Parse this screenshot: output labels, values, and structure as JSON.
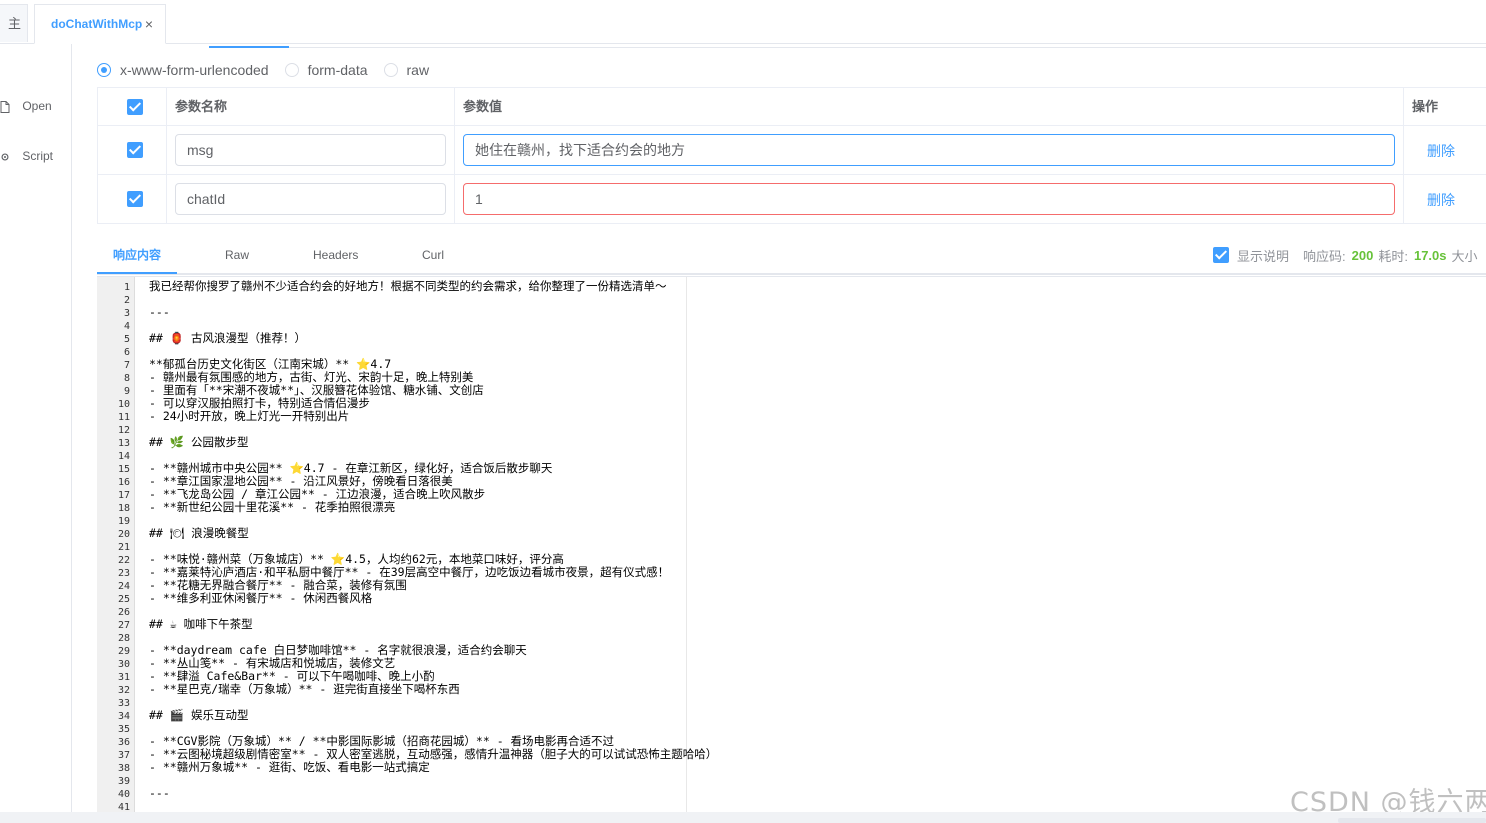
{
  "tabs": {
    "home_label": "主页",
    "active_label": "doChatWithMcp",
    "close_glyph": "×"
  },
  "left_rail": [
    {
      "label": "Open",
      "icon": "document-icon"
    },
    {
      "label": "Script",
      "icon": "gear-icon"
    }
  ],
  "body_types": [
    {
      "label": "x-www-form-urlencoded",
      "checked": true
    },
    {
      "label": "form-data",
      "checked": false
    },
    {
      "label": "raw",
      "checked": false
    }
  ],
  "params_table": {
    "headers": {
      "name": "参数名称",
      "value": "参数值",
      "action": "操作"
    },
    "rows": [
      {
        "enabled": true,
        "name": "msg",
        "value": "她住在赣州，找下适合约会的地方",
        "action": "删除"
      },
      {
        "enabled": true,
        "name": "chatId",
        "value": "1",
        "action": "删除"
      }
    ]
  },
  "response_tabs": [
    "响应内容",
    "Raw",
    "Headers",
    "Curl"
  ],
  "response_info": {
    "show_desc_label": "显示说明",
    "show_desc_checked": true,
    "status_label": "响应码:",
    "status_value": "200",
    "time_label": "耗时:",
    "time_value": "17.0s",
    "size_label": "大小"
  },
  "code_lines": [
    "我已经帮你搜罗了赣州不少适合约会的好地方！根据不同类型的约会需求，给你整理了一份精选清单～",
    "",
    "---",
    "",
    "## 🏮 古风浪漫型（推荐！）",
    "",
    "**郁孤台历史文化街区（江南宋城）** ⭐4.7",
    "- 赣州最有氛围感的地方，古街、灯光、宋韵十足，晚上特别美",
    "- 里面有「**宋潮不夜城**」、汉服簪花体验馆、糖水铺、文创店",
    "- 可以穿汉服拍照打卡，特别适合情侣漫步",
    "- 24小时开放，晚上灯光一开特别出片",
    "",
    "## 🌿 公园散步型",
    "",
    "- **赣州城市中央公园** ⭐4.7 - 在章江新区，绿化好，适合饭后散步聊天",
    "- **章江国家湿地公园** - 沿江风景好，傍晚看日落很美",
    "- **飞龙岛公园 / 章江公园** - 江边浪漫，适合晚上吹风散步",
    "- **新世纪公园十里花溪** - 花季拍照很漂亮",
    "",
    "## 🍽 浪漫晚餐型",
    "",
    "- **味悦·赣州菜（万象城店）** ⭐4.5，人均约62元，本地菜口味好，评分高",
    "- **嘉莱特沁庐酒店·和平私厨中餐厅** - 在39层高空中餐厅，边吃饭边看城市夜景，超有仪式感！",
    "- **花糖无界融合餐厅** - 融合菜，装修有氛围",
    "- **维多利亚休闲餐厅** - 休闲西餐风格",
    "",
    "## ☕ 咖啡下午茶型",
    "",
    "- **daydream cafe 白日梦咖啡馆** - 名字就很浪漫，适合约会聊天",
    "- **丛山笺** - 有宋城店和悦城店，装修文艺",
    "- **肆溢 Cafe&Bar** - 可以下午喝咖啡、晚上小酌",
    "- **星巴克/瑞幸（万象城）** - 逛完街直接坐下喝杯东西",
    "",
    "## 🎬 娱乐互动型",
    "",
    "- **CGV影院（万象城）** / **中影国际影城（招商花园城）** - 看场电影再合适不过",
    "- **云图秘境超级剧情密室** - 双人密室逃脱，互动感强，感情升温神器（胆子大的可以试试恐怖主题哈哈）",
    "- **赣州万象城** - 逛街、吃饭、看电影一站式搞定",
    "",
    "---",
    ""
  ],
  "watermark": "CSDN @钱六两",
  "colors": {
    "accent": "#409eff",
    "success": "#67c23a",
    "danger": "#f56c6c"
  }
}
